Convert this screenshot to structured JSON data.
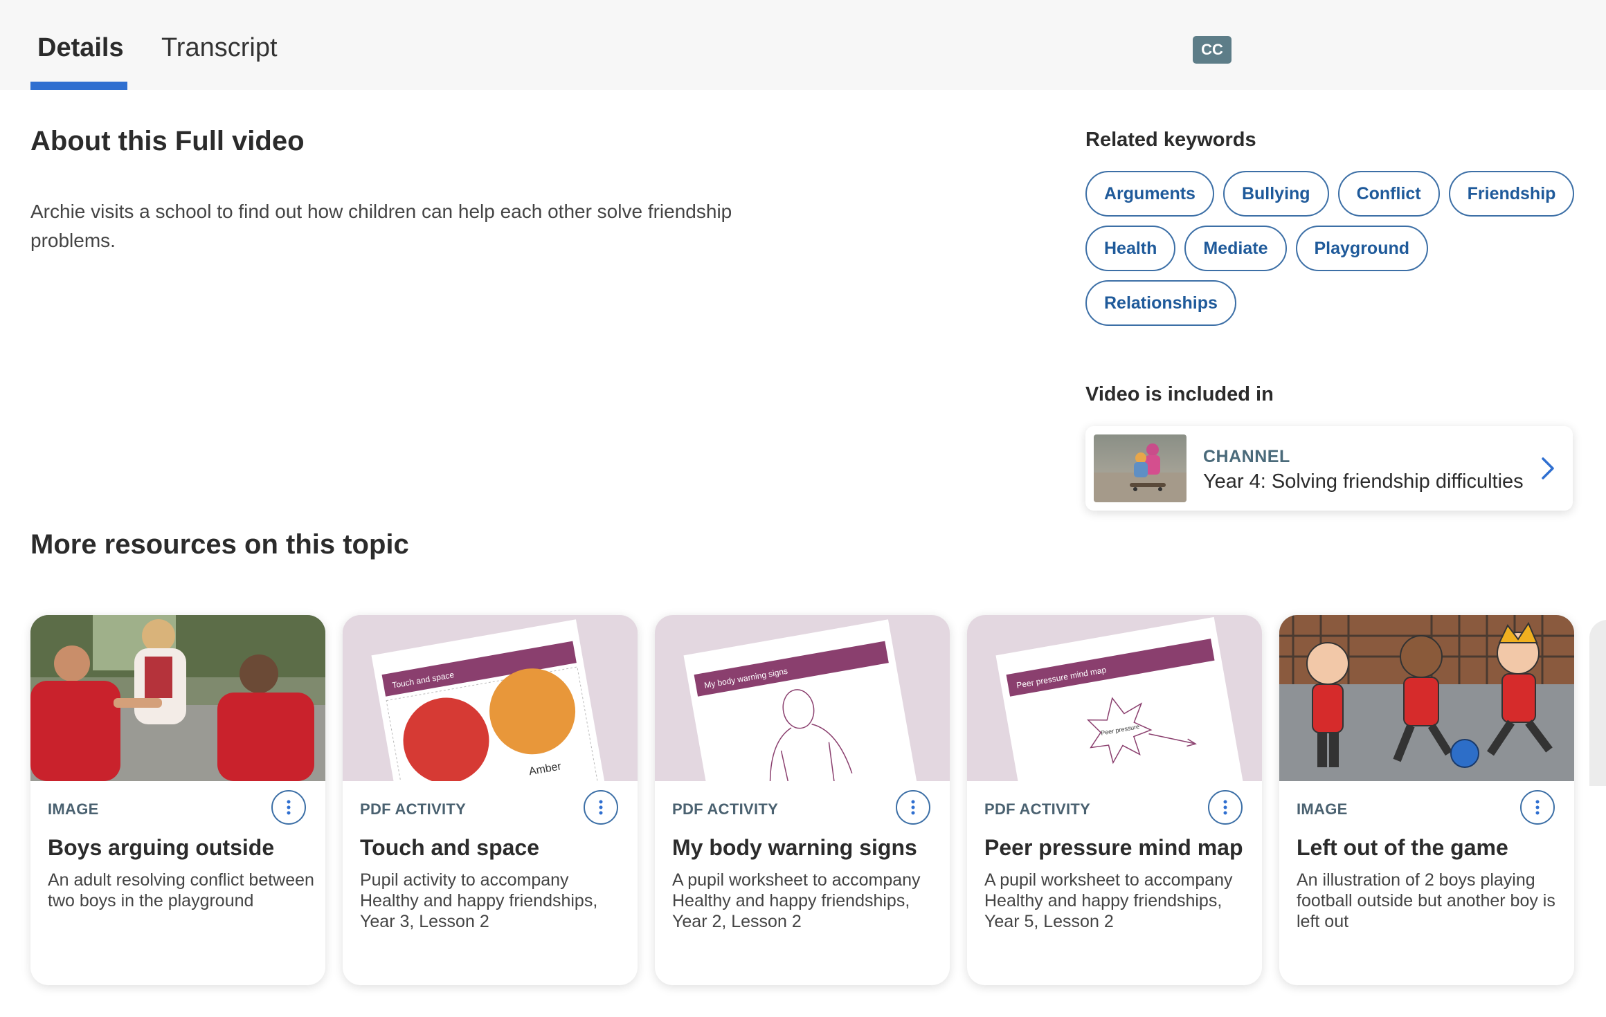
{
  "tabs": {
    "details": "Details",
    "transcript": "Transcript",
    "cc": "CC"
  },
  "about": {
    "title": "About this Full video",
    "description": "Archie visits a school to find out how children can help each other solve friendship problems."
  },
  "related_keywords": {
    "label": "Related keywords",
    "items": [
      "Arguments",
      "Bullying",
      "Conflict",
      "Friendship",
      "Health",
      "Mediate",
      "Playground",
      "Relationships"
    ]
  },
  "included_in": {
    "label": "Video is included in",
    "kind": "CHANNEL",
    "title": "Year 4: Solving friendship difficulties",
    "icon": "chevron-right-icon"
  },
  "more_resources": {
    "title": "More resources on this topic",
    "cards": [
      {
        "type": "IMAGE",
        "title": "Boys arguing outside",
        "description": "An adult resolving conflict between two boys in the playground"
      },
      {
        "type": "PDF ACTIVITY",
        "title": "Touch and space",
        "description": "Pupil activity to accompany Healthy and happy friendships, Year 3, Lesson 2"
      },
      {
        "type": "PDF ACTIVITY",
        "title": "My body warning signs",
        "description": "A pupil worksheet to accompany Healthy and happy friendships, Year 2, Lesson 2"
      },
      {
        "type": "PDF ACTIVITY",
        "title": "Peer pressure mind map",
        "description": "A pupil worksheet to accompany Healthy and happy friendships, Year 5, Lesson 2"
      },
      {
        "type": "IMAGE",
        "title": "Left out of the game",
        "description": "An illustration of 2 boys playing football outside but another boy is left out"
      }
    ],
    "thumbnails": {
      "worksheet_headers": [
        "Touch and space",
        "My body warning signs",
        "Peer pressure mind map"
      ],
      "circle_label": "Amber",
      "mindmap_label": "Peer pressure"
    }
  },
  "colors": {
    "accent": "#2f6fd0",
    "pill_text": "#1f5a9a",
    "cc_badge": "#5d7d88",
    "worksheet_band": "#8a3f6e"
  }
}
